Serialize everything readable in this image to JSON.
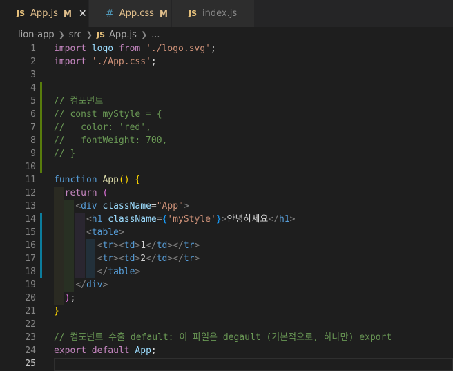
{
  "tabs": [
    {
      "icon": "JS",
      "label": "App.js",
      "badge": "M",
      "close": "✕",
      "active": true,
      "modified": true
    },
    {
      "icon": "#",
      "label": "App.css",
      "badge": "M",
      "active": false,
      "modified": true
    },
    {
      "icon": "JS",
      "label": "index.js",
      "badge": "",
      "active": false,
      "modified": false
    }
  ],
  "breadcrumb": {
    "folder1": "lion-app",
    "folder2": "src",
    "file_icon": "JS",
    "file": "App.js",
    "more": "..."
  },
  "editor": {
    "lines": [
      {
        "n": "1",
        "tokens": [
          [
            "kw",
            "import"
          ],
          [
            "def",
            " "
          ],
          [
            "var",
            "logo"
          ],
          [
            "def",
            " "
          ],
          [
            "kw",
            "from"
          ],
          [
            "def",
            " "
          ],
          [
            "str",
            "'./logo.svg'"
          ],
          [
            "def",
            ";"
          ]
        ]
      },
      {
        "n": "2",
        "tokens": [
          [
            "kw",
            "import"
          ],
          [
            "def",
            " "
          ],
          [
            "str",
            "'./App.css'"
          ],
          [
            "def",
            ";"
          ]
        ]
      },
      {
        "n": "3",
        "tokens": []
      },
      {
        "n": "4",
        "tokens": []
      },
      {
        "n": "5",
        "tokens": [
          [
            "cmt",
            "// 컴포넌트"
          ]
        ]
      },
      {
        "n": "6",
        "tokens": [
          [
            "cmt",
            "// const myStyle = {"
          ]
        ]
      },
      {
        "n": "7",
        "tokens": [
          [
            "cmt",
            "//   color: 'red',"
          ]
        ]
      },
      {
        "n": "8",
        "tokens": [
          [
            "cmt",
            "//   fontWeight: 700,"
          ]
        ]
      },
      {
        "n": "9",
        "tokens": [
          [
            "cmt",
            "// }"
          ]
        ]
      },
      {
        "n": "10",
        "tokens": []
      },
      {
        "n": "11",
        "tokens": [
          [
            "kw2",
            "function"
          ],
          [
            "def",
            " "
          ],
          [
            "fn",
            "App"
          ],
          [
            "br1",
            "()"
          ],
          [
            "def",
            " "
          ],
          [
            "br1",
            "{"
          ]
        ]
      },
      {
        "n": "12",
        "tokens": [
          [
            "def",
            "  "
          ],
          [
            "kw",
            "return"
          ],
          [
            "def",
            " "
          ],
          [
            "br2",
            "("
          ]
        ]
      },
      {
        "n": "13",
        "tokens": [
          [
            "def",
            "    "
          ],
          [
            "pun",
            "<"
          ],
          [
            "tag",
            "div"
          ],
          [
            "def",
            " "
          ],
          [
            "attr",
            "className"
          ],
          [
            "def",
            "="
          ],
          [
            "str",
            "\"App\""
          ],
          [
            "pun",
            ">"
          ]
        ]
      },
      {
        "n": "14",
        "tokens": [
          [
            "def",
            "      "
          ],
          [
            "pun",
            "<"
          ],
          [
            "tag",
            "h1"
          ],
          [
            "def",
            " "
          ],
          [
            "attr",
            "className"
          ],
          [
            "def",
            "="
          ],
          [
            "br3",
            "{"
          ],
          [
            "str",
            "'myStyle'"
          ],
          [
            "br3",
            "}"
          ],
          [
            "pun",
            ">"
          ],
          [
            "def",
            "안녕하세요"
          ],
          [
            "pun",
            "</"
          ],
          [
            "tag",
            "h1"
          ],
          [
            "pun",
            ">"
          ]
        ]
      },
      {
        "n": "15",
        "tokens": [
          [
            "def",
            "      "
          ],
          [
            "pun",
            "<"
          ],
          [
            "tag",
            "table"
          ],
          [
            "pun",
            ">"
          ]
        ]
      },
      {
        "n": "16",
        "tokens": [
          [
            "def",
            "        "
          ],
          [
            "pun",
            "<"
          ],
          [
            "tag",
            "tr"
          ],
          [
            "pun",
            "><"
          ],
          [
            "tag",
            "td"
          ],
          [
            "pun",
            ">"
          ],
          [
            "def",
            "1"
          ],
          [
            "pun",
            "</"
          ],
          [
            "tag",
            "td"
          ],
          [
            "pun",
            "></"
          ],
          [
            "tag",
            "tr"
          ],
          [
            "pun",
            ">"
          ]
        ]
      },
      {
        "n": "17",
        "tokens": [
          [
            "def",
            "        "
          ],
          [
            "pun",
            "<"
          ],
          [
            "tag",
            "tr"
          ],
          [
            "pun",
            "><"
          ],
          [
            "tag",
            "td"
          ],
          [
            "pun",
            ">"
          ],
          [
            "def",
            "2"
          ],
          [
            "pun",
            "</"
          ],
          [
            "tag",
            "td"
          ],
          [
            "pun",
            "></"
          ],
          [
            "tag",
            "tr"
          ],
          [
            "pun",
            ">"
          ]
        ]
      },
      {
        "n": "18",
        "tokens": [
          [
            "def",
            "        "
          ],
          [
            "pun",
            "</"
          ],
          [
            "tag",
            "table"
          ],
          [
            "pun",
            ">"
          ]
        ]
      },
      {
        "n": "19",
        "tokens": [
          [
            "def",
            "    "
          ],
          [
            "pun",
            "</"
          ],
          [
            "tag",
            "div"
          ],
          [
            "pun",
            ">"
          ]
        ]
      },
      {
        "n": "20",
        "tokens": [
          [
            "def",
            "  "
          ],
          [
            "br2",
            ")"
          ],
          [
            "def",
            ";"
          ]
        ]
      },
      {
        "n": "21",
        "tokens": [
          [
            "br1",
            "}"
          ]
        ]
      },
      {
        "n": "22",
        "tokens": []
      },
      {
        "n": "23",
        "tokens": [
          [
            "cmt",
            "// 컴포넌트 수출 default: 이 파일은 degault (기본적으로, 하나만) export"
          ]
        ]
      },
      {
        "n": "24",
        "tokens": [
          [
            "kw",
            "export"
          ],
          [
            "def",
            " "
          ],
          [
            "kw",
            "default"
          ],
          [
            "def",
            " "
          ],
          [
            "var",
            "App"
          ],
          [
            "def",
            ";"
          ]
        ]
      },
      {
        "n": "25",
        "tokens": []
      }
    ],
    "current_line": "25"
  },
  "colors": {
    "background": "#1e1e1e",
    "tab_inactive": "#2d2d2d",
    "modified": "#e2c08d",
    "keyword": "#c586c0",
    "string": "#ce9178",
    "comment": "#6a9955",
    "tag": "#569cd6",
    "attribute": "#9cdcfe",
    "gutter_added": "#587c0c",
    "gutter_modified": "#0c7d9d"
  }
}
